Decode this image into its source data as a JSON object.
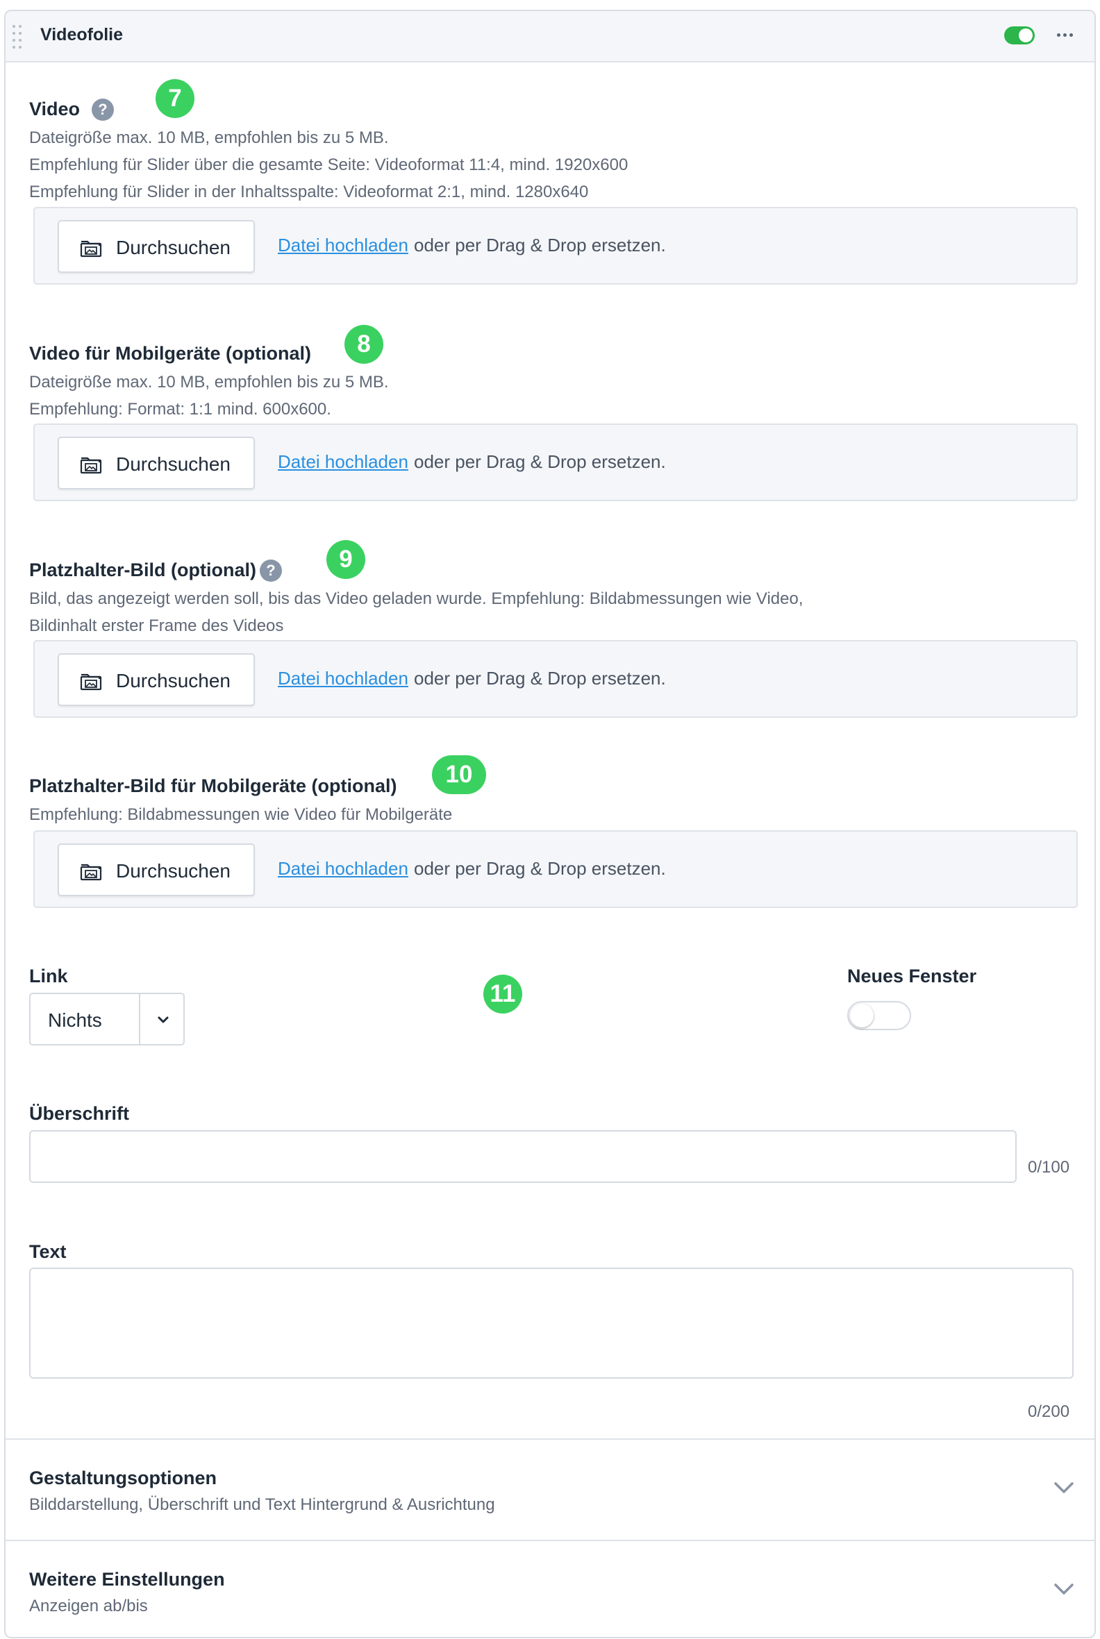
{
  "header": {
    "title": "Videofolie",
    "enabled": true
  },
  "video": {
    "label": "Video",
    "badge": "7",
    "desc_lines": [
      "Dateigröße max. 10 MB, empfohlen bis zu 5 MB.",
      "Empfehlung für Slider über die gesamte Seite: Videoformat 11:4, mind. 1920x600",
      "Empfehlung für Slider in der Inhaltsspalte: Videoformat 2:1, mind. 1280x640"
    ]
  },
  "video_mobile": {
    "label": "Video für Mobilgeräte (optional)",
    "badge": "8",
    "desc_lines": [
      "Dateigröße max. 10 MB, empfohlen bis zu 5 MB.",
      "Empfehlung: Format: 1:1 mind. 600x600."
    ]
  },
  "placeholder": {
    "label": "Platzhalter-Bild (optional)",
    "badge": "9",
    "desc_lines": [
      "Bild, das angezeigt werden soll, bis das Video geladen wurde. Empfehlung: Bildabmessungen wie Video,",
      "Bildinhalt erster Frame des Videos"
    ]
  },
  "placeholder_mobile": {
    "label": "Platzhalter-Bild für Mobilgeräte (optional)",
    "badge": "10",
    "desc_lines": [
      "Empfehlung: Bildabmessungen wie Video für Mobilgeräte"
    ]
  },
  "upload": {
    "browse_label": "Durchsuchen",
    "link_label": "Datei hochladen",
    "hint": "oder per Drag & Drop ersetzen."
  },
  "link": {
    "label": "Link",
    "badge": "11",
    "selected": "Nichts"
  },
  "new_window": {
    "label": "Neues Fenster",
    "enabled": false
  },
  "heading": {
    "label": "Überschrift",
    "value": "",
    "counter": "0/100"
  },
  "text": {
    "label": "Text",
    "value": "",
    "counter": "0/200"
  },
  "sections": [
    {
      "title": "Gestaltungsoptionen",
      "subtitle": "Bilddarstellung, Überschrift und Text Hintergrund & Ausrichtung"
    },
    {
      "title": "Weitere Einstellungen",
      "subtitle": "Anzeigen ab/bis"
    }
  ],
  "colors": {
    "accent_green": "#2bb54a",
    "badge_green": "#3bd160",
    "link_blue": "#2a8fe0"
  }
}
